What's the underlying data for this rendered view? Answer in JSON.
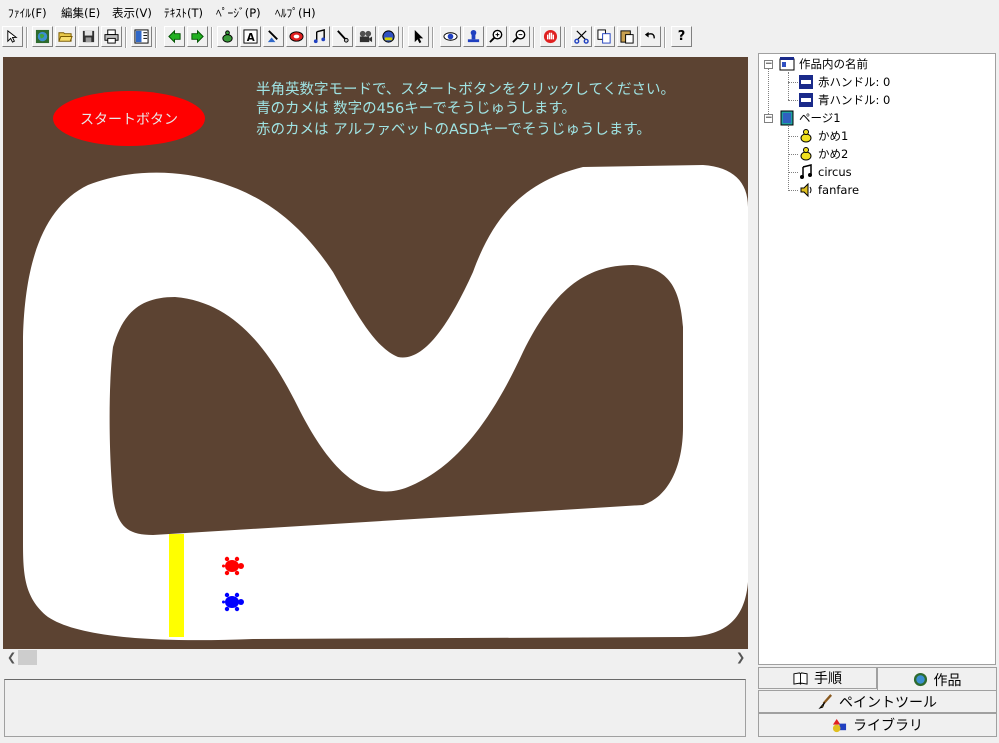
{
  "menu": {
    "file": "ﾌｧｲﾙ(F)",
    "edit": "編集(E)",
    "view": "表示(V)",
    "text": "ﾃｷｽﾄ(T)",
    "page": "ﾍﾟｰｼﾞ(P)",
    "help": "ﾍﾙﾌﾟ(H)"
  },
  "toolbar": {
    "icons": [
      "pointer-icon",
      "globe-icon",
      "open-folder-icon",
      "save-icon",
      "print-icon",
      "layout-icon",
      "prev-page-icon",
      "next-page-icon",
      "turtle-icon",
      "text-icon",
      "paint-icon",
      "button-icon",
      "music-icon",
      "pen-icon",
      "movie-icon",
      "sound-icon",
      "select-arrow-icon",
      "eye-icon",
      "stamp-icon",
      "zoom-in-icon",
      "zoom-out-icon",
      "stop-icon",
      "cut-icon",
      "copy-icon",
      "paste-icon",
      "undo-icon",
      "help-icon"
    ],
    "help_label": "?"
  },
  "stage": {
    "start_button": "スタートボタン",
    "instructions": [
      "半角英数字モードで、スタートボタンをクリックしてください。",
      "青のカメは 数字の456キーでそうじゅうします。",
      "赤のカメは アルファベットのASDキーでそうじゅうします。"
    ],
    "colors": {
      "background": "#5c4332",
      "track": "#ffffff",
      "goal_line": "#ffff00",
      "red_turtle": "#ff0000",
      "blue_turtle": "#0000ff",
      "text": "#9fe3e3"
    }
  },
  "tree": {
    "root": "作品内の名前",
    "variables": [
      "赤ハンドル: 0",
      "青ハンドル: 0"
    ],
    "page": "ページ1",
    "page_items": [
      "かめ1",
      "かめ2",
      "circus",
      "fanfare"
    ]
  },
  "tabs": {
    "procedure": "手順",
    "work": "作品",
    "paint_tool": "ペイントツール",
    "library": "ライブラリ"
  }
}
